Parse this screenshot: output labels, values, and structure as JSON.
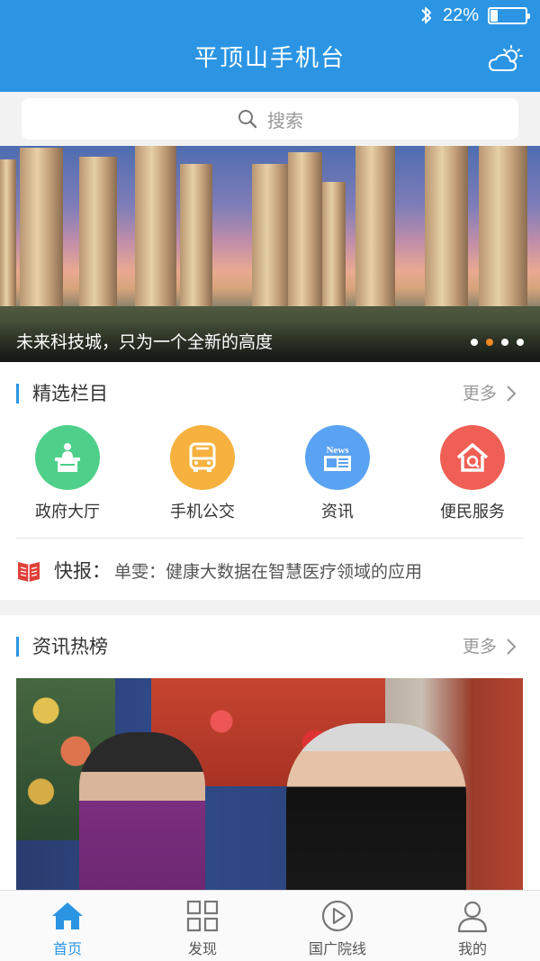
{
  "status_bar": {
    "battery_percent": "22%",
    "battery_level": 0.22
  },
  "header": {
    "title": "平顶山手机台"
  },
  "search": {
    "placeholder": "搜索"
  },
  "banner": {
    "caption": "未来科技城，只为一个全新的高度",
    "slide_count": 4,
    "active_slide": 1
  },
  "featured": {
    "title": "精选栏目",
    "more": "更多",
    "items": [
      {
        "label": "政府大厅",
        "color": "#4fd08a",
        "icon": "government-hall-icon"
      },
      {
        "label": "手机公交",
        "color": "#f7b13f",
        "icon": "bus-icon"
      },
      {
        "label": "资讯",
        "color": "#5aa2f2",
        "icon": "news-icon"
      },
      {
        "label": "便民服务",
        "color": "#ef5f55",
        "icon": "home-service-icon"
      }
    ],
    "news_icon_text": "News"
  },
  "news_flash": {
    "label": "快报",
    "colon": "：",
    "text": "单雯：健康大数据在智慧医疗领域的应用"
  },
  "hot_news": {
    "title": "资讯热榜",
    "more": "更多"
  },
  "tabbar": {
    "tabs": [
      {
        "label": "首页",
        "active": true
      },
      {
        "label": "发现",
        "active": false
      },
      {
        "label": "国广院线",
        "active": false
      },
      {
        "label": "我的",
        "active": false
      }
    ]
  },
  "colors": {
    "primary": "#2b95e3",
    "accent_dot": "#f08a24"
  }
}
